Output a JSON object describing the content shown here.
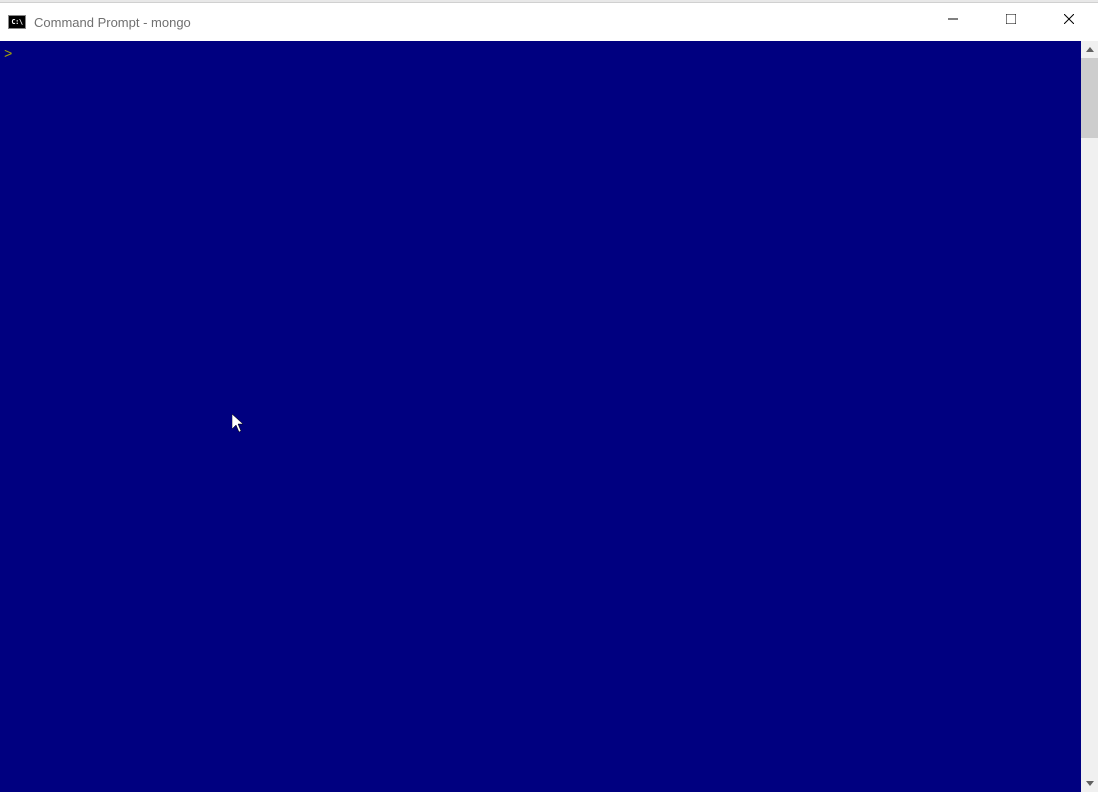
{
  "window": {
    "title": "Command Prompt - mongo",
    "app_icon_label": "C:\\"
  },
  "terminal": {
    "prompt": ">",
    "background_color": "#000080",
    "prompt_color": "#aaaa00"
  },
  "controls": {
    "minimize": "minimize",
    "maximize": "maximize",
    "close": "close"
  }
}
